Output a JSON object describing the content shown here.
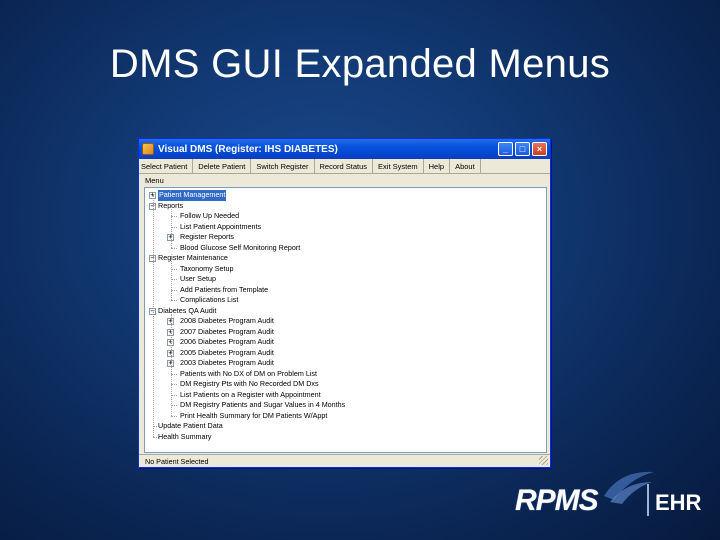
{
  "slide": {
    "title": "DMS GUI Expanded Menus"
  },
  "window": {
    "title": "Visual DMS (Register: IHS DIABETES)",
    "controls": {
      "minimize": "_",
      "maximize": "□",
      "close": "×"
    }
  },
  "menubar": [
    "Select Patient",
    "Delete Patient",
    "Switch Register",
    "Record Status",
    "Exit System",
    "Help",
    "About"
  ],
  "panel_label": "Menu",
  "tree": [
    {
      "label": "Patient Management",
      "level": 0,
      "expander": "+",
      "selected": true
    },
    {
      "label": "Reports",
      "level": 0,
      "expander": "−"
    },
    {
      "label": "Follow Up Needed",
      "level": 1
    },
    {
      "label": "List Patient Appointments",
      "level": 1
    },
    {
      "label": "Register Reports",
      "level": 1,
      "expander": "+"
    },
    {
      "label": "Blood Glucose Self Monitoring Report",
      "level": 1
    },
    {
      "label": "Register Maintenance",
      "level": 0,
      "expander": "−"
    },
    {
      "label": "Taxonomy Setup",
      "level": 1
    },
    {
      "label": "User Setup",
      "level": 1
    },
    {
      "label": "Add Patients from Template",
      "level": 1
    },
    {
      "label": "Complications List",
      "level": 1
    },
    {
      "label": "Diabetes QA Audit",
      "level": 0,
      "expander": "−"
    },
    {
      "label": "2008 Diabetes Program Audit",
      "level": 1,
      "expander": "+"
    },
    {
      "label": "2007 Diabetes Program Audit",
      "level": 1,
      "expander": "+"
    },
    {
      "label": "2006 Diabetes Program Audit",
      "level": 1,
      "expander": "+"
    },
    {
      "label": "2005 Diabetes Program Audit",
      "level": 1,
      "expander": "+"
    },
    {
      "label": "2003 Diabetes Program Audit",
      "level": 1,
      "expander": "+"
    },
    {
      "label": "Patients with No DX of DM on Problem List",
      "level": 1
    },
    {
      "label": "DM Registry Pts with No Recorded DM Dxs",
      "level": 1
    },
    {
      "label": "List Patients on a Register with Appointment",
      "level": 1
    },
    {
      "label": "DM Registry Patients and Sugar Values in 4 Months",
      "level": 1
    },
    {
      "label": "Print Health Summary for DM Patients W/Appt",
      "level": 1
    },
    {
      "label": "Update Patient Data",
      "level": 0
    },
    {
      "label": "Health Summary",
      "level": 0
    }
  ],
  "status": "No Patient Selected",
  "logo": {
    "name": "RPMS",
    "sub": "EHR"
  }
}
